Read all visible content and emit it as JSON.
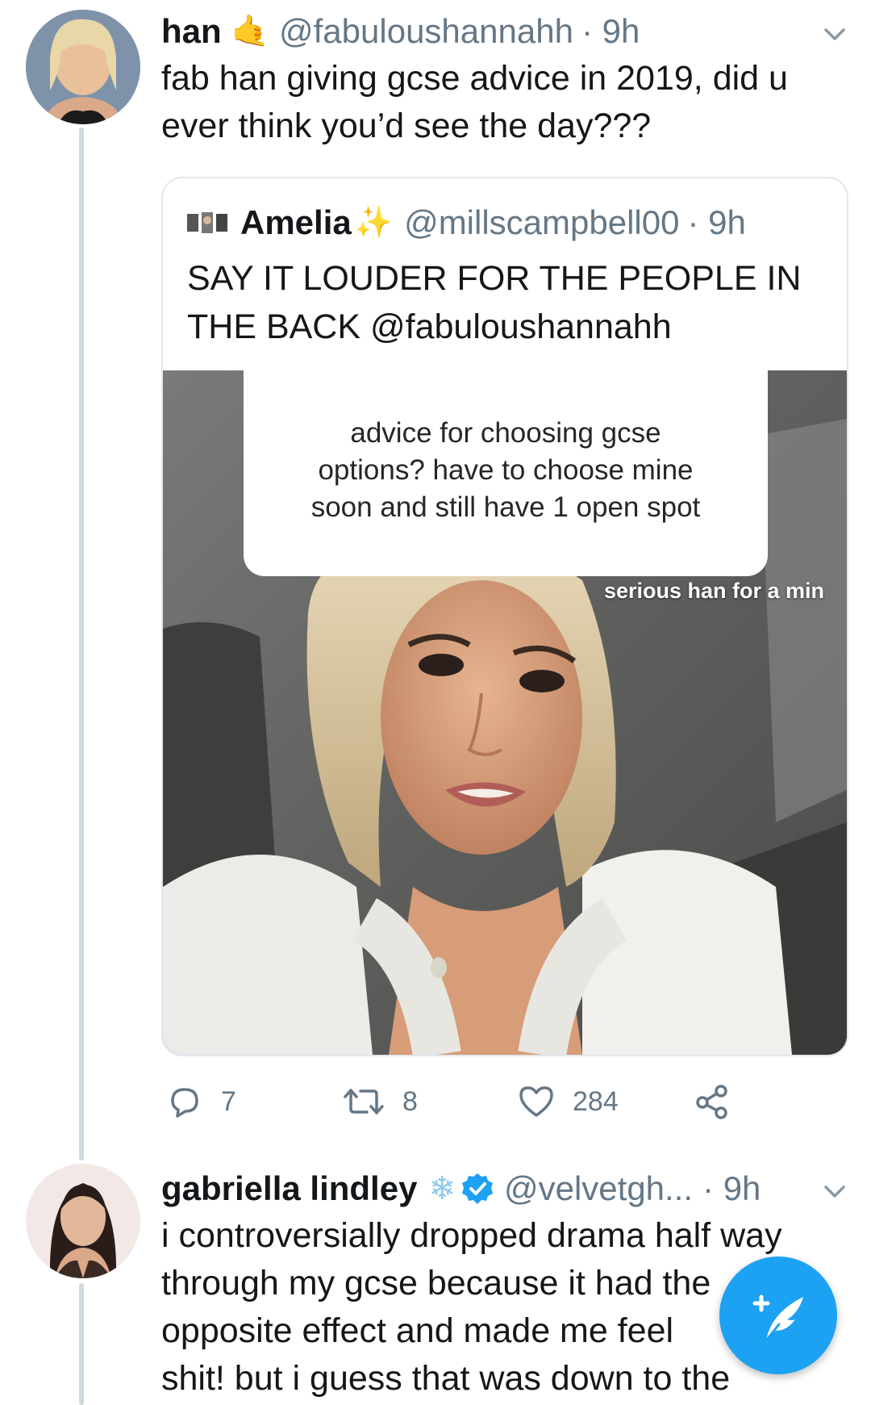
{
  "tweet1": {
    "name": "han",
    "emoji": "🤙",
    "handle": "@fabuloushannahh",
    "time": "· 9h",
    "text_line1": "fab han giving gcse advice in 2019, did u",
    "text_line2": "ever think you’d see the day???"
  },
  "quote": {
    "name": "Amelia",
    "sparkle": "✨",
    "handle": "@millscampbell00",
    "time": "· 9h",
    "text_line1": "SAY IT LOUDER FOR THE PEOPLE IN",
    "text_line2": "THE BACK @fabuloushannahh",
    "media": {
      "question_line1": "advice for choosing gcse",
      "question_line2": "options? have to choose mine",
      "question_line3": "soon and still have 1 open spot",
      "caption": "serious han for a min"
    }
  },
  "actions": {
    "replies": "7",
    "retweets": "8",
    "likes": "284"
  },
  "tweet2": {
    "name": "gabriella lindley",
    "snowflake": "❄",
    "handle": "@velvetgh...",
    "time": "· 9h",
    "text_line1": "i controversially dropped drama half way",
    "text_line2": "through my gcse because it had the",
    "text_line3": "opposite effect and made me feel",
    "text_line4": "shit! but i guess that was down to the"
  },
  "colors": {
    "accent": "#1da1f2",
    "secondary_text": "#657786",
    "border": "#e1e8ed"
  },
  "icons": {
    "reply": "reply-icon",
    "retweet": "retweet-icon",
    "like": "heart-icon",
    "share": "share-icon",
    "compose": "compose-tweet-icon",
    "chevron": "chevron-down-icon",
    "verified": "verified-badge-icon"
  }
}
